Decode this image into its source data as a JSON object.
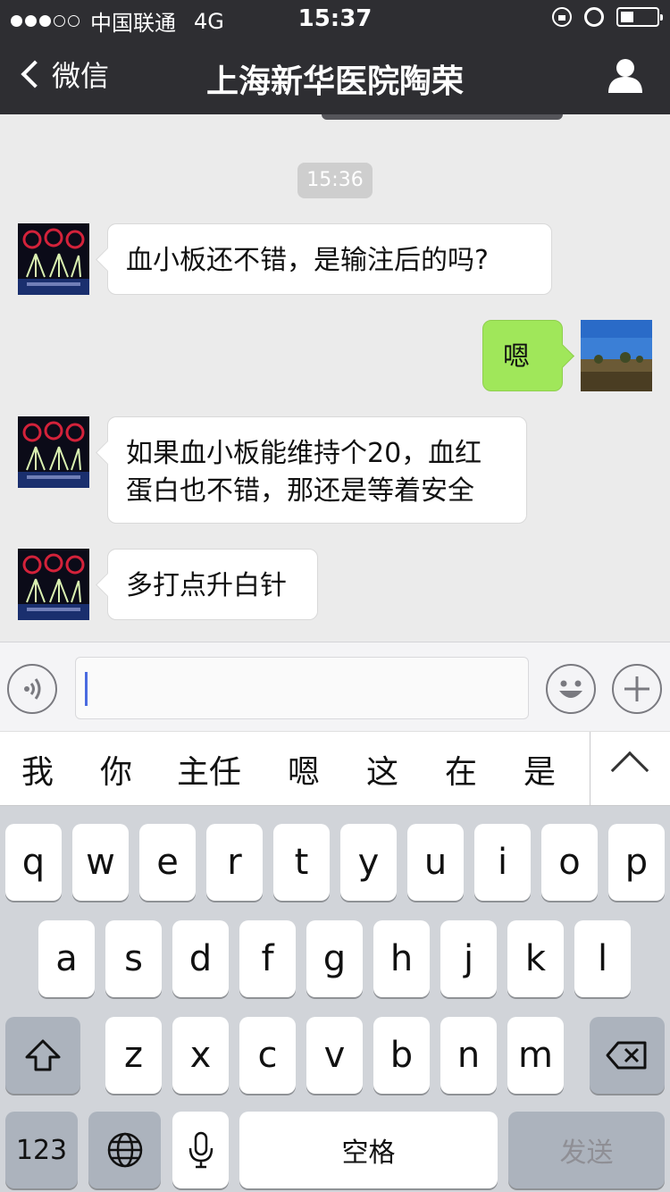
{
  "status_bar": {
    "carrier": "中国联通",
    "network": "4G",
    "time": "15:37"
  },
  "nav": {
    "back_label": "微信",
    "title": "上海新华医院陶荣"
  },
  "chat": {
    "timestamp": "15:36",
    "messages": [
      {
        "side": "in",
        "text": "血小板还不错，是输注后的吗?"
      },
      {
        "side": "out",
        "text": "嗯"
      },
      {
        "side": "in",
        "line1": "如果血小板能维持个20，血红",
        "line2": "蛋白也不错，那还是等着安全"
      },
      {
        "side": "in",
        "text": "多打点升白针"
      }
    ]
  },
  "input": {
    "value": ""
  },
  "candidates": [
    "我",
    "你",
    "主任",
    "嗯",
    "这",
    "在",
    "是"
  ],
  "keyboard": {
    "row1": [
      "q",
      "w",
      "e",
      "r",
      "t",
      "y",
      "u",
      "i",
      "o",
      "p"
    ],
    "row2": [
      "a",
      "s",
      "d",
      "f",
      "g",
      "h",
      "j",
      "k",
      "l"
    ],
    "row3": [
      "z",
      "x",
      "c",
      "v",
      "b",
      "n",
      "m"
    ],
    "numbers_label": "123",
    "space_label": "空格",
    "send_label": "发送"
  },
  "icons": {
    "back": "chevron-left-icon",
    "profile": "person-icon",
    "voice": "voice-icon",
    "emoji": "emoji-icon",
    "plus": "plus-icon",
    "shift": "shift-icon",
    "delete": "backspace-icon",
    "globe": "globe-icon",
    "mic": "microphone-icon"
  },
  "colors": {
    "nav_bg": "#2e2e32",
    "out_bubble": "#a0e75a",
    "chat_bg": "#ebebeb"
  }
}
